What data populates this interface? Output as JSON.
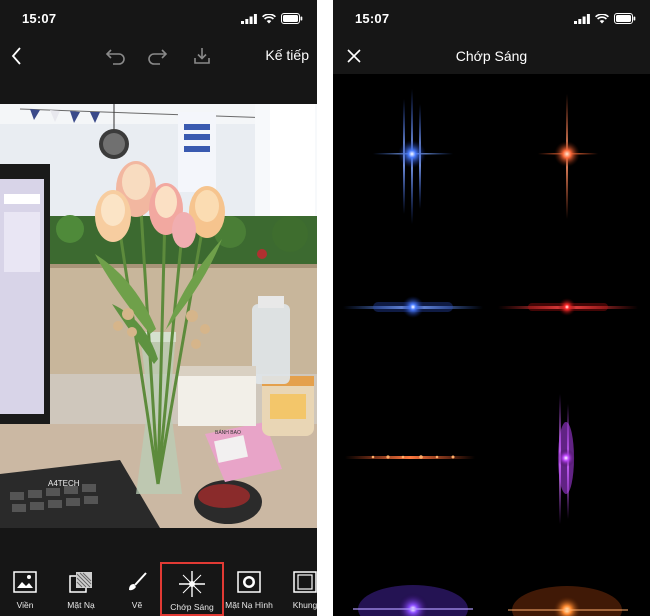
{
  "left_screen": {
    "status_time": "15:07",
    "nav": {
      "next_label": "Kế tiếp"
    },
    "tools": [
      {
        "label": "Viền",
        "icon": "frame-picture-icon"
      },
      {
        "label": "Mặt Nạ",
        "icon": "mask-icon"
      },
      {
        "label": "Vẽ",
        "icon": "brush-icon"
      },
      {
        "label": "Chớp Sáng",
        "icon": "flare-icon",
        "selected": true
      },
      {
        "label": "Mặt Nạ Hình",
        "icon": "shape-mask-icon"
      },
      {
        "label": "Khung",
        "icon": "border-frame-icon"
      }
    ],
    "photo_texts": {
      "vase_card": "BÁNH BAO",
      "keyboard_brand": "A4TECH"
    }
  },
  "right_screen": {
    "status_time": "15:07",
    "title": "Chớp Sáng",
    "flares": [
      {
        "name": "blue-vertical-star",
        "color": "#3b6dff"
      },
      {
        "name": "orange-vertical-star",
        "color": "#ff6a3a"
      },
      {
        "name": "blue-horizontal-streak",
        "color": "#3f7bff"
      },
      {
        "name": "red-horizontal-streak",
        "color": "#ff2a2a"
      },
      {
        "name": "orange-dotted-streak",
        "color": "#ff5a2a"
      },
      {
        "name": "purple-vertical-star",
        "color": "#c048ff"
      },
      {
        "name": "violet-glow",
        "color": "#8a4dff"
      },
      {
        "name": "amber-glow",
        "color": "#ff8a30"
      }
    ]
  }
}
